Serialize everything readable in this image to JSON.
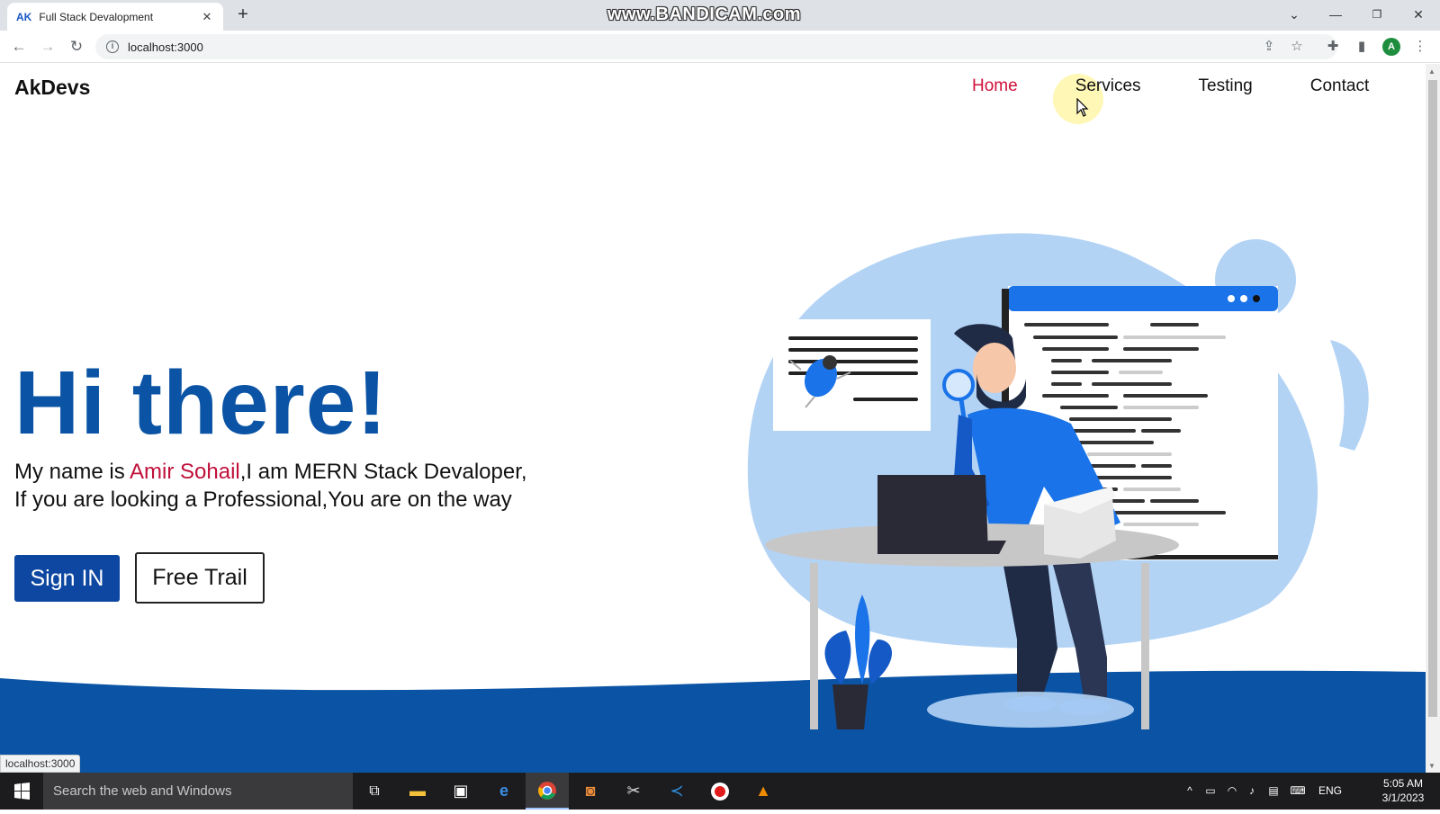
{
  "browser": {
    "tab_favicon": "AK",
    "tab_title": "Full Stack Devalopment",
    "tab_close": "✕",
    "new_tab": "+",
    "url": "localhost:3000",
    "watermark": "www.BANDICAM.com",
    "status_tooltip": "localhost:3000",
    "profile_initial": "A"
  },
  "page": {
    "logo": "AkDevs",
    "nav": [
      {
        "label": "Home",
        "active": true
      },
      {
        "label": "Services",
        "active": false
      },
      {
        "label": "Testing",
        "active": false
      },
      {
        "label": "Contact",
        "active": false
      }
    ],
    "hero": {
      "title": "Hi there!",
      "line1_prefix": "My name is ",
      "line1_name": "Amir Sohail",
      "line1_suffix": ",I am MERN Stack Devaloper,",
      "line2": "If you are looking a Professional,You are on the way",
      "signin_label": "Sign IN",
      "trial_label": "Free Trail"
    },
    "colors": {
      "primary_blue": "#0b54a5",
      "accent_red": "#d0103a",
      "illustration_light_blue": "#b3d3f5",
      "illustration_blue": "#1a73e8",
      "wave_blue": "#0b54a5"
    }
  },
  "taskbar": {
    "search_placeholder": "Search the web and Windows",
    "language": "ENG",
    "time": "5:05 AM",
    "date": "3/1/2023",
    "apps": [
      "task-view-icon",
      "file-explorer-icon",
      "store-icon",
      "edge-icon",
      "chrome-icon",
      "photos-icon",
      "snipping-icon",
      "vscode-icon",
      "recorder-icon",
      "vlc-icon"
    ]
  }
}
